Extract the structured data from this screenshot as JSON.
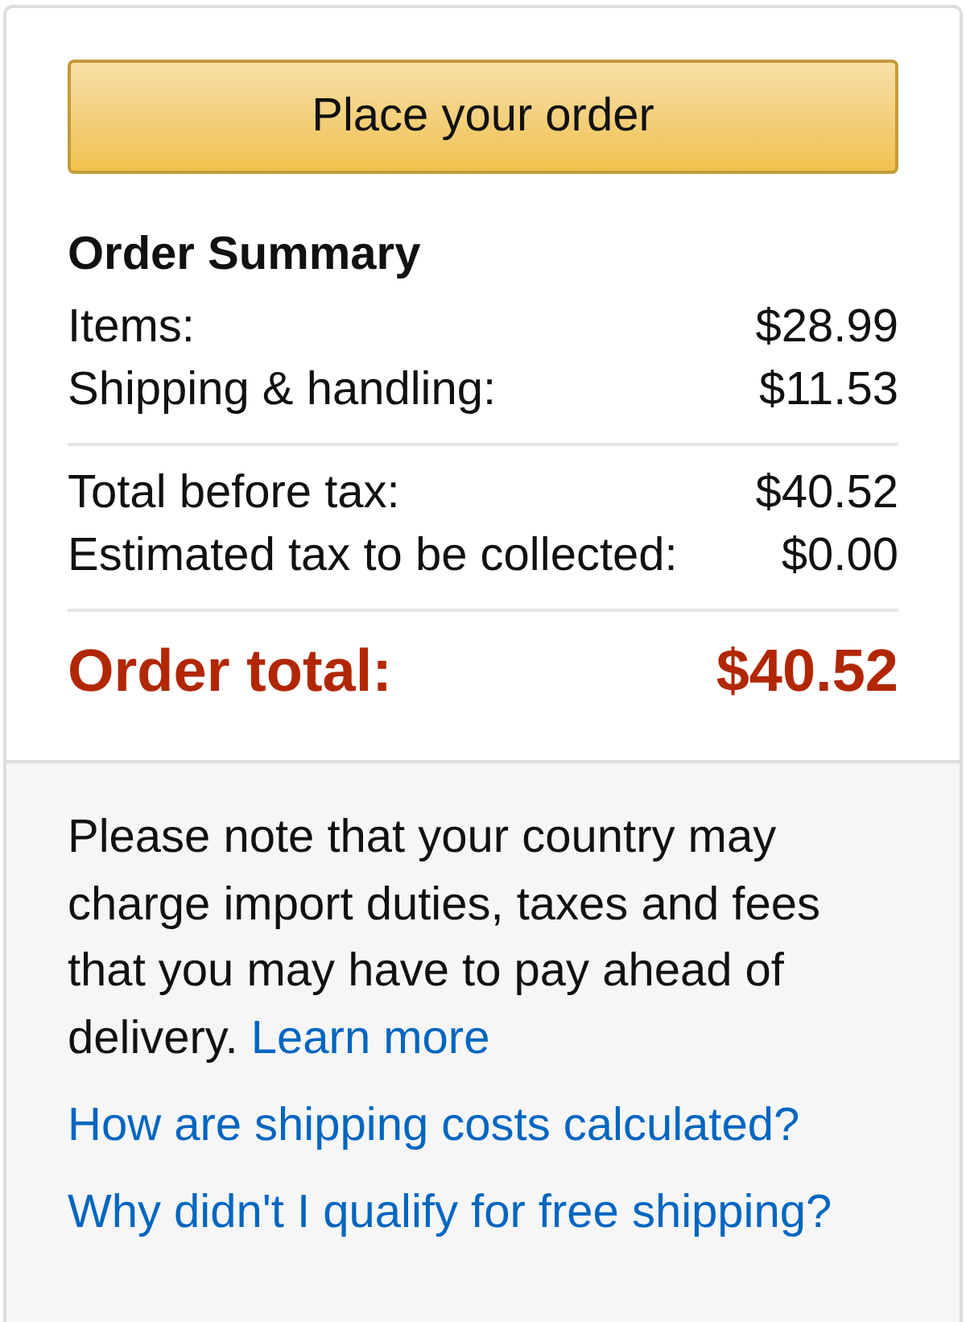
{
  "primary_button": {
    "label": "Place your order"
  },
  "summary": {
    "title": "Order Summary",
    "sections": [
      {
        "lines": [
          {
            "label": "Items:",
            "amount": "$28.99"
          },
          {
            "label": "Shipping & handling:",
            "amount": "$11.53"
          }
        ]
      },
      {
        "lines": [
          {
            "label": "Total before tax:",
            "amount": "$40.52"
          },
          {
            "label": "Estimated tax to be collected:",
            "amount": "$0.00"
          }
        ]
      }
    ],
    "total": {
      "label": "Order total:",
      "amount": "$40.52"
    }
  },
  "notice": {
    "text": "Please note that your country may charge import duties, taxes and fees that you may have to pay ahead of delivery.",
    "link": "Learn more"
  },
  "links": [
    "How are shipping costs calculated?",
    "Why didn't I qualify for free shipping?"
  ]
}
